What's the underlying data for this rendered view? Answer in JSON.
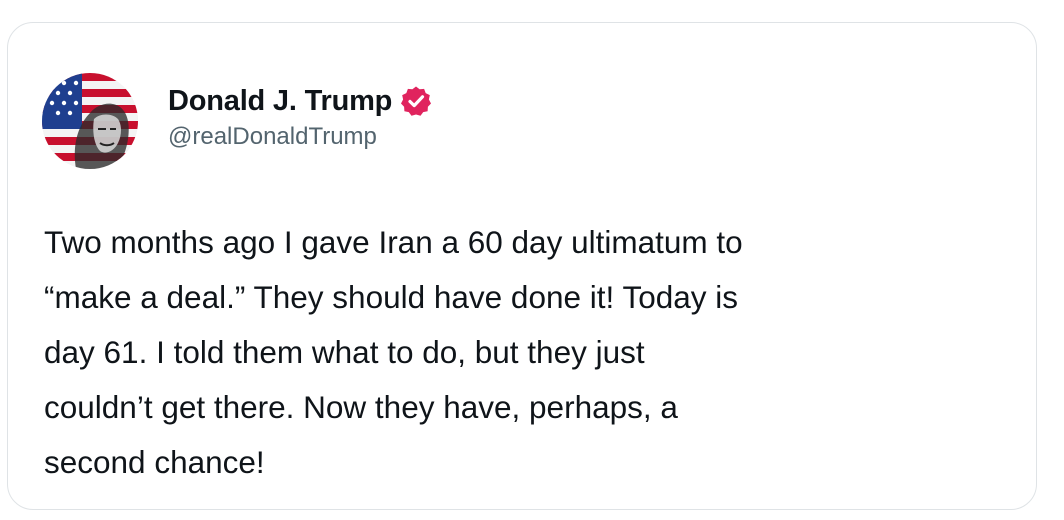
{
  "post": {
    "author": {
      "display_name": "Donald J. Trump",
      "handle": "@realDonaldTrump",
      "verified": true,
      "verified_badge_color": "#e0245e",
      "avatar_icon": "flag-portrait-avatar"
    },
    "body": "Two months ago I gave Iran a 60 day ultimatum to\n“make a deal.” They should have done it! Today is\nday 61. I told them what to do, but they just\ncouldn’t get there. Now they have, perhaps, a\nsecond chance!"
  },
  "colors": {
    "text_primary": "#0f1419",
    "text_secondary": "#53646e",
    "card_border": "#dfe3e6",
    "flag_red": "#c8102e",
    "flag_blue": "#1f3f8f"
  }
}
